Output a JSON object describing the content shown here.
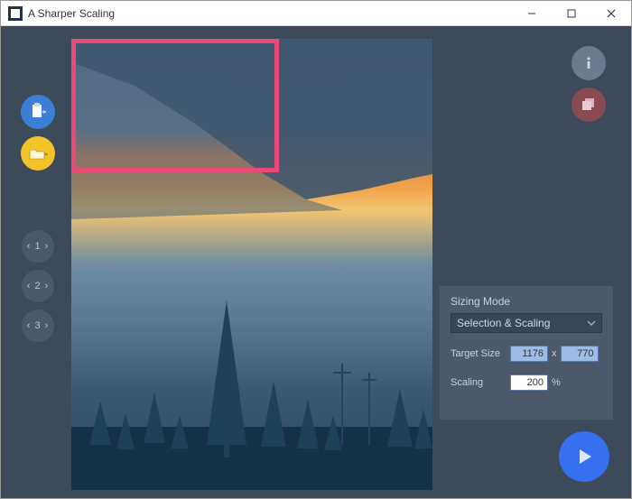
{
  "window": {
    "title": "A Sharper Scaling"
  },
  "toolbar_left": {
    "paste": "paste-icon",
    "open": "open-folder-icon"
  },
  "toolbar_right": {
    "info": "info-icon",
    "layers": "layers-icon"
  },
  "presets": {
    "p1": "‹ 1 ›",
    "p2": "‹ 2 ›",
    "p3": "‹ 3 ›"
  },
  "panel": {
    "sizing_mode_label": "Sizing Mode",
    "sizing_mode_value": "Selection & Scaling",
    "target_size_label": "Target Size",
    "target_width": "1176",
    "target_sep": "x",
    "target_height": "770",
    "scaling_label": "Scaling",
    "scaling_value": "200",
    "scaling_unit": "%"
  }
}
